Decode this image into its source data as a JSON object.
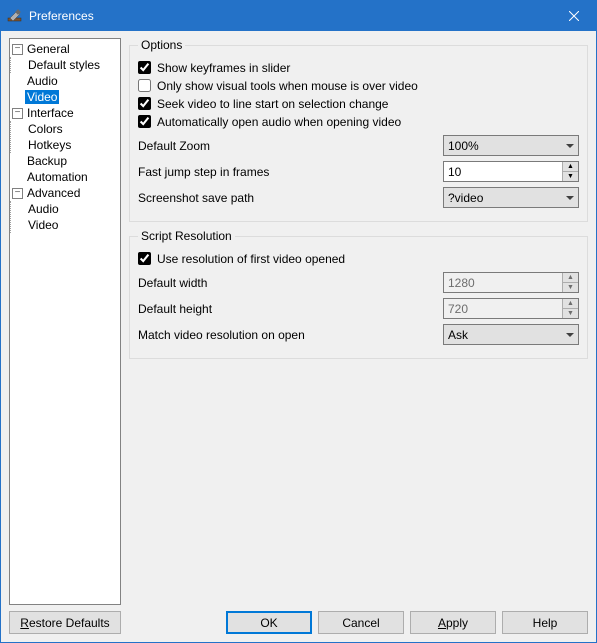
{
  "window": {
    "title": "Preferences"
  },
  "tree": {
    "general": {
      "label": "General",
      "default_styles": "Default styles"
    },
    "audio": "Audio",
    "video": "Video",
    "interface": {
      "label": "Interface",
      "colors": "Colors",
      "hotkeys": "Hotkeys"
    },
    "backup": "Backup",
    "automation": "Automation",
    "advanced": {
      "label": "Advanced",
      "audio": "Audio",
      "video": "Video"
    }
  },
  "options": {
    "legend": "Options",
    "show_keyframes": "Show keyframes in slider",
    "only_visual": "Only show visual tools when mouse is over video",
    "seek_line": "Seek video to line start on selection change",
    "auto_audio": "Automatically open audio when opening video",
    "default_zoom_label": "Default Zoom",
    "default_zoom_value": "100%",
    "fast_jump_label": "Fast jump step in frames",
    "fast_jump_value": "10",
    "screenshot_label": "Screenshot save path",
    "screenshot_value": "?video"
  },
  "script_res": {
    "legend": "Script Resolution",
    "use_first": "Use resolution of first video opened",
    "def_width_label": "Default width",
    "def_width_value": "1280",
    "def_height_label": "Default height",
    "def_height_value": "720",
    "match_label": "Match video resolution on open",
    "match_value": "Ask"
  },
  "buttons": {
    "restore": "estore Defaults",
    "restore_u": "R",
    "ok": "OK",
    "cancel": "Cancel",
    "apply": "pply",
    "apply_u": "A",
    "help": "Help"
  }
}
